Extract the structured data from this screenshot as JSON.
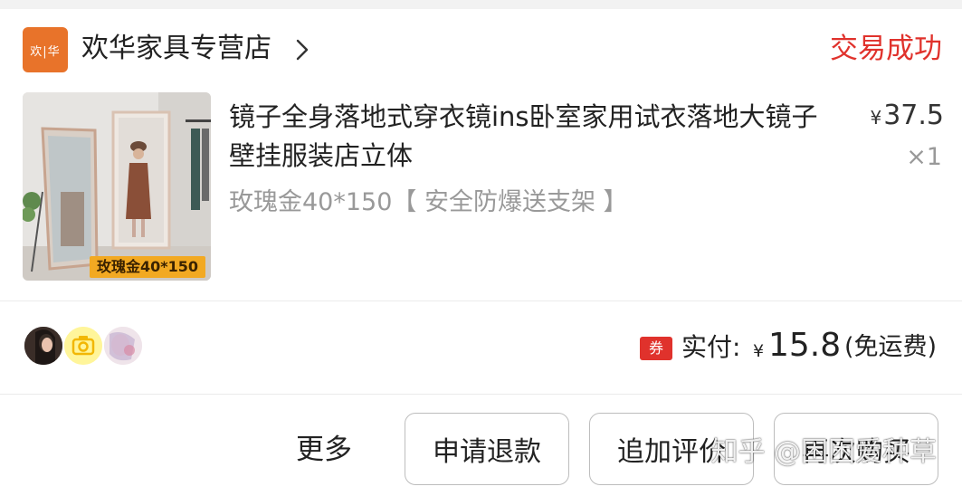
{
  "shop": {
    "logo_text": "欢|华",
    "name": "欢华家具专营店",
    "status": "交易成功",
    "status_color": "#e0322c",
    "brand_color": "#e8732a"
  },
  "product": {
    "title": "镜子全身落地式穿衣镜ins卧室家用试衣落地大镜子壁挂服装店立体",
    "spec": "玫瑰金40*150【 安全防爆送支架 】",
    "thumb_tag": "玫瑰金40*150",
    "price_symbol": "¥",
    "price": "37.5",
    "quantity": "×1"
  },
  "summary": {
    "avatars": [
      "avatar-user-1",
      "camera-icon",
      "avatar-user-3"
    ],
    "coupon_badge": "券",
    "paid_label": "实付:",
    "paid_symbol": "¥",
    "paid_amount": "15.8",
    "shipping_note": "(免运费)"
  },
  "actions": {
    "more": "更多",
    "refund": "申请退款",
    "add_review": "追加评价",
    "reorder": "再次购买"
  },
  "watermark": "知乎 @困困爱种草"
}
